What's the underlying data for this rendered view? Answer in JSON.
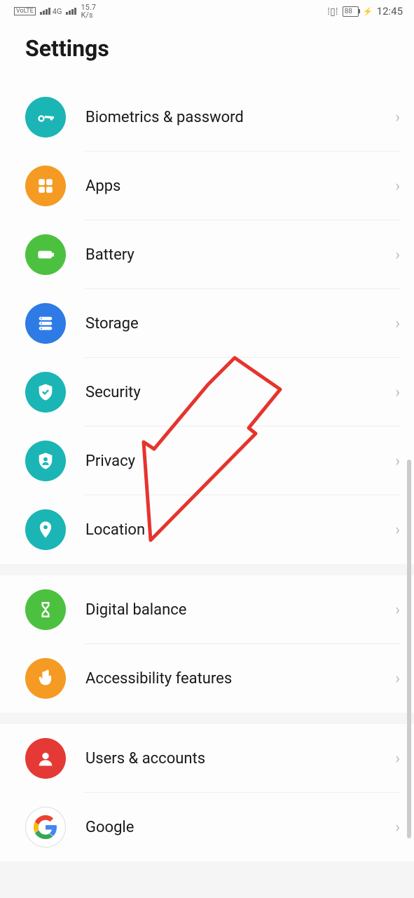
{
  "status_bar": {
    "volte": "VoLTE",
    "network": "4G",
    "speed_value": "15.7",
    "speed_unit": "K/s",
    "battery": "88",
    "time": "12:45"
  },
  "header": {
    "title": "Settings"
  },
  "sections": [
    {
      "items": [
        {
          "label": "Biometrics & password",
          "icon": "key",
          "color": "teal"
        },
        {
          "label": "Apps",
          "icon": "apps",
          "color": "orange"
        },
        {
          "label": "Battery",
          "icon": "battery",
          "color": "green"
        },
        {
          "label": "Storage",
          "icon": "storage",
          "color": "blue"
        },
        {
          "label": "Security",
          "icon": "shield-check",
          "color": "teal"
        },
        {
          "label": "Privacy",
          "icon": "shield-user",
          "color": "teal"
        },
        {
          "label": "Location",
          "icon": "pin",
          "color": "teal"
        }
      ]
    },
    {
      "items": [
        {
          "label": "Digital balance",
          "icon": "hourglass",
          "color": "green"
        },
        {
          "label": "Accessibility features",
          "icon": "hand",
          "color": "orange"
        }
      ]
    },
    {
      "items": [
        {
          "label": "Users & accounts",
          "icon": "user",
          "color": "red"
        },
        {
          "label": "Google",
          "icon": "google",
          "color": "white"
        }
      ]
    }
  ]
}
